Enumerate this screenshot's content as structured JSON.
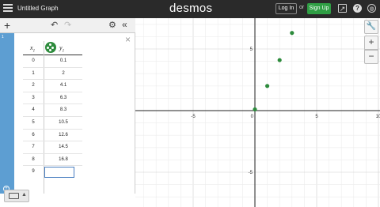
{
  "header": {
    "title": "Untitled Graph",
    "brand": "desmos",
    "login_label": "Log In",
    "or_text": "or",
    "signup_label": "Sign Up",
    "icons": [
      "menu-icon",
      "share-icon",
      "help-icon",
      "globe-icon"
    ],
    "help_glyph": "?",
    "brand_color": "#2a2a2a",
    "signup_color": "#2f9e44"
  },
  "toolbar": {
    "add_glyph": "+",
    "icons": [
      "add-icon",
      "undo-icon",
      "redo-icon",
      "gear-icon",
      "collapse-icon"
    ]
  },
  "expressions": {
    "index": "1",
    "close_glyph": "×",
    "table": {
      "x_header": "x",
      "x_sub": "1",
      "y_header": "y",
      "y_sub": "1",
      "series_color": "#2d8b3c",
      "rows": [
        {
          "x": "0",
          "y": "0.1"
        },
        {
          "x": "1",
          "y": "2"
        },
        {
          "x": "2",
          "y": "4.1"
        },
        {
          "x": "3",
          "y": "6.3"
        },
        {
          "x": "4",
          "y": "8.3"
        },
        {
          "x": "5",
          "y": "10.5"
        },
        {
          "x": "6",
          "y": "12.6"
        },
        {
          "x": "7",
          "y": "14.5"
        },
        {
          "x": "8",
          "y": "16.8"
        },
        {
          "x": "9",
          "y": ""
        }
      ]
    }
  },
  "graph": {
    "x_ticks": [
      "-10",
      "-5",
      "0",
      "5",
      "10"
    ],
    "y_ticks": [
      "5",
      "-5"
    ],
    "controls": {
      "zoom_in": "+",
      "zoom_out": "−"
    },
    "point_color": "#2d8b3c",
    "visible_points": [
      [
        0,
        0.1
      ],
      [
        1,
        2
      ],
      [
        2,
        4.1
      ],
      [
        3,
        6.3
      ]
    ]
  }
}
